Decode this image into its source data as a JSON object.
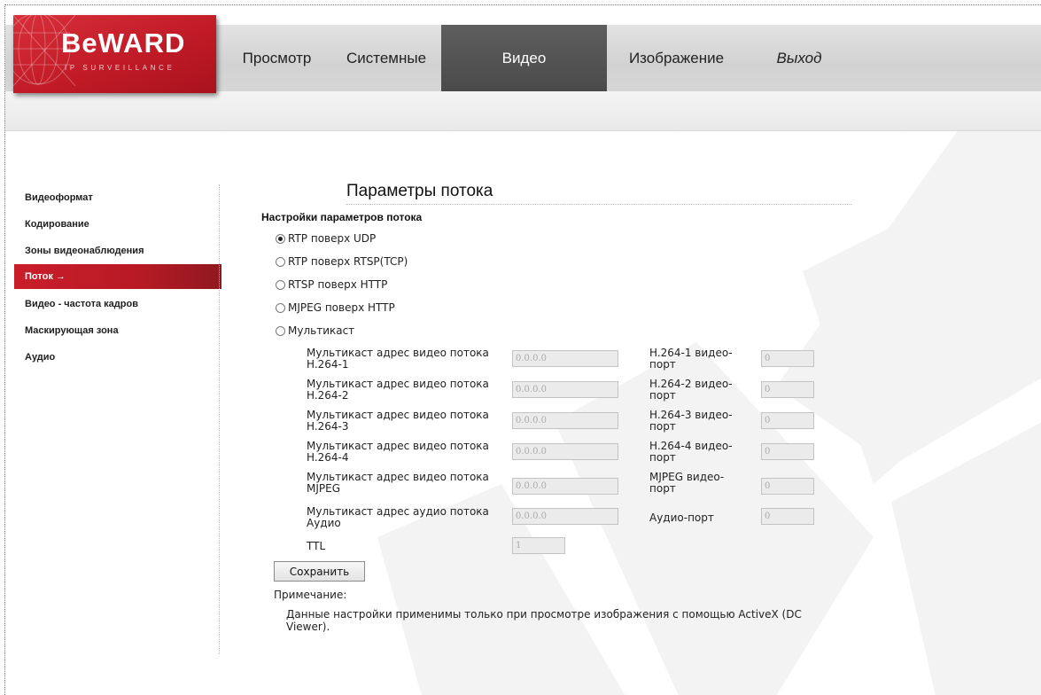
{
  "logo": {
    "name": "BeWARD",
    "tagline": "IP SURVEILLANCE"
  },
  "nav": [
    {
      "label": "Просмотр"
    },
    {
      "label": "Системные"
    },
    {
      "label": "Видео",
      "active": true
    },
    {
      "label": "Изображение"
    },
    {
      "label": "Выход"
    }
  ],
  "sidebar": {
    "items": [
      {
        "label": "Видеоформат"
      },
      {
        "label": "Кодирование"
      },
      {
        "label": "Зоны видеонаблюдения"
      },
      {
        "label": "Поток →",
        "active": true
      },
      {
        "label": "Видео - частота кадров"
      },
      {
        "label": "Маскирующая зона"
      },
      {
        "label": "Аудио"
      }
    ]
  },
  "page_title": "Параметры потока",
  "section_title": "Настройки параметров потока",
  "transport_options": [
    {
      "label": "RTP поверх UDP",
      "selected": true
    },
    {
      "label": "RTP поверх RTSP(TCP)",
      "selected": false
    },
    {
      "label": "RTSP поверх HTTP",
      "selected": false
    },
    {
      "label": "MJPEG поверх HTTP",
      "selected": false
    },
    {
      "label": "Мультикаст",
      "selected": false
    }
  ],
  "multicast": {
    "rows": [
      {
        "addr_label_1": "Мультикаст адрес видео потока",
        "addr_label_2": "H.264-1",
        "addr_value": "0.0.0.0",
        "port_label_1": "H.264-1 видео-",
        "port_label_2": "порт",
        "port_value": "0"
      },
      {
        "addr_label_1": "Мультикаст адрес видео потока",
        "addr_label_2": "H.264-2",
        "addr_value": "0.0.0.0",
        "port_label_1": "H.264-2 видео-",
        "port_label_2": "порт",
        "port_value": "0"
      },
      {
        "addr_label_1": "Мультикаст адрес видео потока",
        "addr_label_2": "H.264-3",
        "addr_value": "0.0.0.0",
        "port_label_1": "H.264-3 видео-",
        "port_label_2": "порт",
        "port_value": "0"
      },
      {
        "addr_label_1": "Мультикаст адрес видео потока",
        "addr_label_2": "H.264-4",
        "addr_value": "0.0.0.0",
        "port_label_1": "H.264-4 видео-",
        "port_label_2": "порт",
        "port_value": "0"
      },
      {
        "addr_label_1": "Мультикаст адрес видео потока",
        "addr_label_2": "MJPEG",
        "addr_value": "0.0.0.0",
        "port_label_1": "MJPEG видео-",
        "port_label_2": "порт",
        "port_value": "0"
      },
      {
        "addr_label_1": "Мультикаст адрес аудио потока",
        "addr_label_2": "Аудио",
        "addr_value": "0.0.0.0",
        "port_label_1": "Аудио-порт",
        "port_label_2": "",
        "port_value": "0"
      }
    ],
    "ttl_label": "TTL",
    "ttl_value": "1"
  },
  "save_label": "Сохранить",
  "note_title": "Примечание:",
  "note_text": "Данные настройки применимы только при просмотре изображения с помощью ActiveX (DC Viewer).",
  "colors": {
    "brand_red": "#c11b27",
    "nav_active": "#4f4f4f",
    "sidebar_active": "#c91e2a"
  }
}
